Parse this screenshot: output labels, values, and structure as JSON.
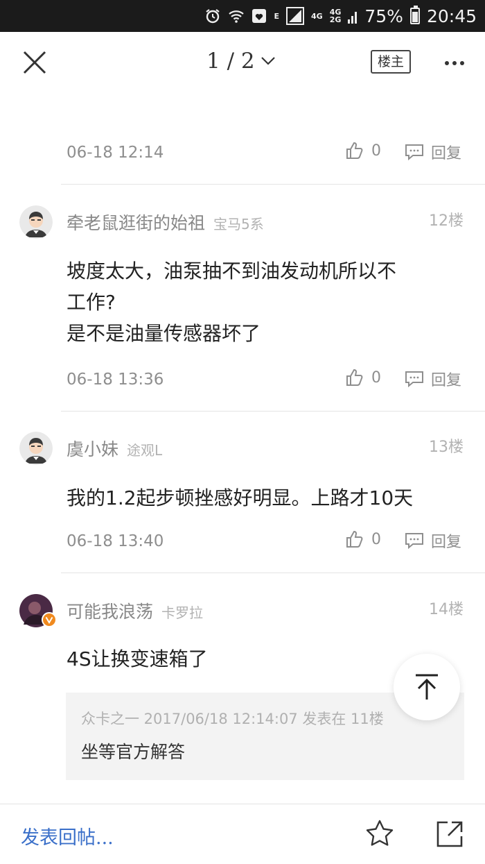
{
  "status_bar": {
    "network_e": "E",
    "network_4g": "4G",
    "network_4g2": "4G",
    "network_2g": "2G",
    "battery": "75%",
    "battery_level": 0.75,
    "time": "20:45"
  },
  "nav": {
    "page_indicator": "1 / 2",
    "owner_button": "楼主"
  },
  "posts": [
    {
      "date": "06-18 12:14",
      "likes": "0",
      "reply_label": "回复"
    },
    {
      "author": "牵老鼠逛街的始祖",
      "car": "宝马5系",
      "floor": "12楼",
      "content_line1": "坡度太大，油泵抽不到油发动机所以不",
      "content_line2": "工作?",
      "content_line3": "是不是油量传感器坏了",
      "date": "06-18 13:36",
      "likes": "0",
      "reply_label": "回复"
    },
    {
      "author": "虞小妹",
      "car": "途观L",
      "floor": "13楼",
      "content_line1": "我的1.2起步顿挫感好明显。上路才10天",
      "date": "06-18 13:40",
      "likes": "0",
      "reply_label": "回复"
    },
    {
      "author": "可能我浪荡",
      "car": "卡罗拉",
      "floor": "14楼",
      "content_line1": "4S让换变速箱了",
      "quote_meta": "众卡之一 2017/06/18 12:14:07 发表在 11楼",
      "quote_text": "坐等官方解答"
    }
  ],
  "bottom": {
    "compose_placeholder": "发表回帖..."
  },
  "colors": {
    "accent": "#3a6fc9",
    "verified_badge": "#f08a1f"
  }
}
